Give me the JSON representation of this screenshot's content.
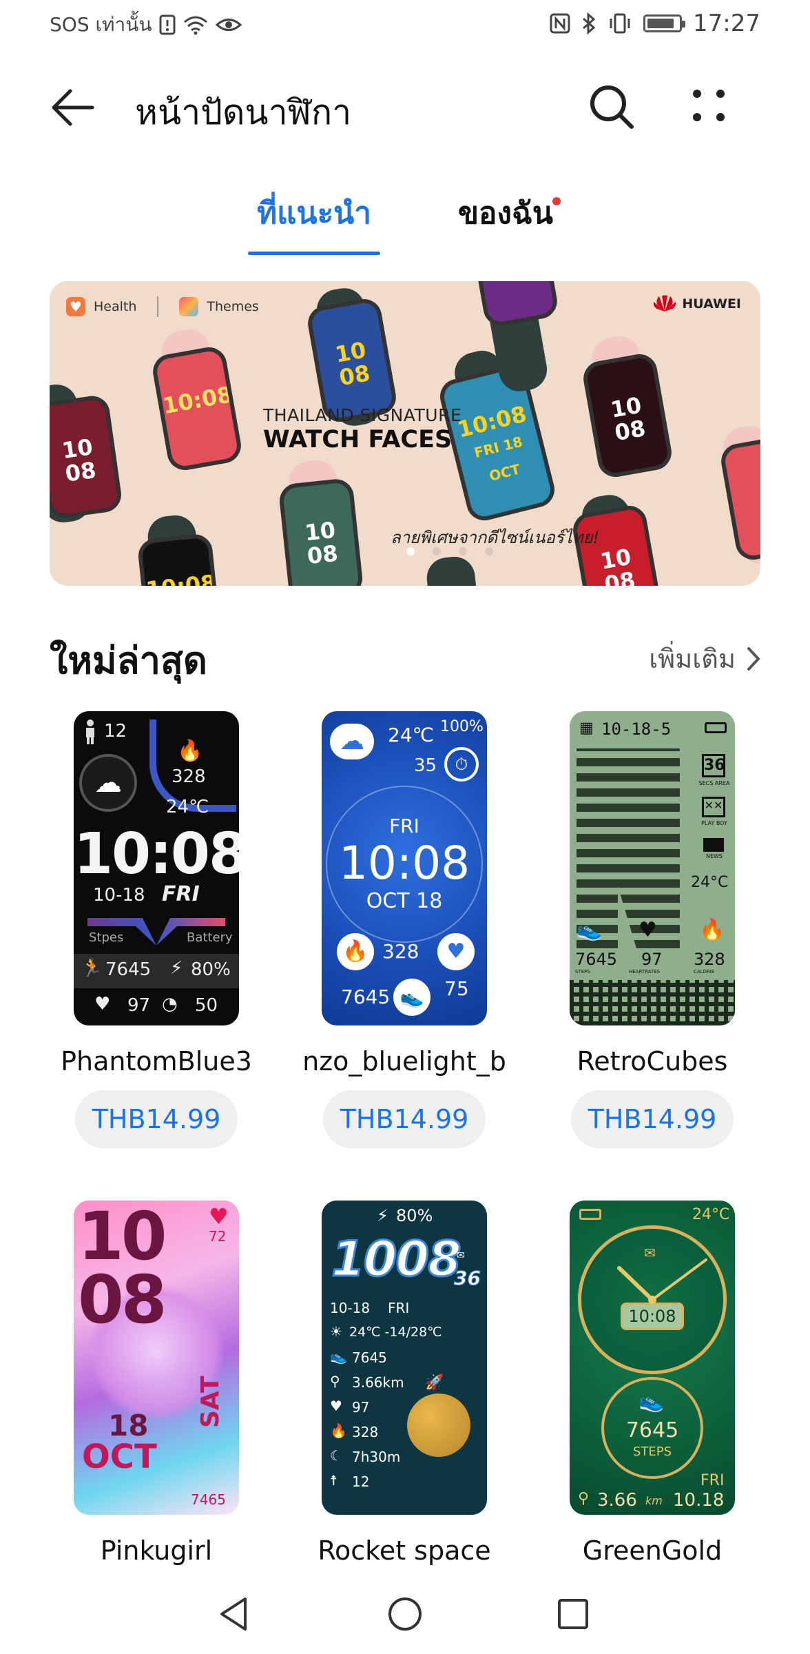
{
  "status_bar": {
    "left_text": "SOS เท่านั้น",
    "time": "17:27",
    "icons": [
      "alert-icon",
      "wifi-icon",
      "eye-icon",
      "nfc-icon",
      "bluetooth-icon",
      "vibrate-icon",
      "battery-icon"
    ]
  },
  "app_bar": {
    "title": "หน้าปัดนาฬิกา",
    "icons": [
      "back-arrow-icon",
      "search-icon",
      "more-icon"
    ]
  },
  "tabs": [
    {
      "label": "ที่แนะนำ",
      "selected": true
    },
    {
      "label": "ของฉัน",
      "selected": false,
      "has_notification_dot": true
    }
  ],
  "banner": {
    "brand_health": "Health",
    "brand_themes": "Themes",
    "brand_huawei": "HUAWEI",
    "headline_line1": "THAILAND SIGNATURE",
    "headline_line2": "WATCH FACES",
    "tagline": "ลายพิเศษจากดีไซน์เนอร์ไทย!",
    "page_count": 4,
    "active_page": 1,
    "colors": {
      "background": "#f1dccb"
    }
  },
  "section": {
    "title": "ใหม่ล่าสุด",
    "more_label": "เพิ่มเติม"
  },
  "items": [
    {
      "name": "PhantomBlue3",
      "price": "THB14.99",
      "face": {
        "time": "10:08",
        "date": "10-18",
        "day": "FRI",
        "temp": "24℃",
        "steps_count": "12",
        "calories": "328",
        "steps": "7645",
        "battery": "80%",
        "heart": "97",
        "stat": "50",
        "label_steps": "Stpes",
        "label_battery": "Battery"
      }
    },
    {
      "name": "nzo_bluelight_b",
      "price": "THB14.99",
      "face": {
        "temp": "24℃",
        "battery": "100%",
        "timer": "35",
        "day": "FRI",
        "time": "10:08",
        "date": "OCT 18",
        "calories": "328",
        "steps": "7645",
        "heart": "75"
      }
    },
    {
      "name": "RetroCubes",
      "price": "THB14.99",
      "face": {
        "date": "10-18-5",
        "secs": "36",
        "secs_label": "SECS AREA",
        "play_label": "PLAY BOY",
        "news_label": "NEWS",
        "temp": "24°C",
        "steps": "7645",
        "heart": "97",
        "calories": "328",
        "steps_label": "STEPS",
        "heart_label": "HEARTRATES",
        "cal_label": "CALORIE"
      }
    },
    {
      "name": "Pinkugirl",
      "face": {
        "hour": "10",
        "minute": "08",
        "day_num": "18",
        "month": "OCT",
        "weekday": "SAT",
        "heart": "72",
        "steps": "7465"
      }
    },
    {
      "name": "Rocket space",
      "face": {
        "battery": "80%",
        "time": "1008",
        "seconds": "36",
        "date": "10-18",
        "day": "FRI",
        "weather": "24℃ -14/28℃",
        "steps": "7645",
        "distance": "3.66km",
        "heart": "97",
        "calories": "328",
        "sleep": "7h30m",
        "stand": "12"
      }
    },
    {
      "name": "GreenGold",
      "face": {
        "temp": "24°C",
        "time": "10:08",
        "steps": "7645",
        "steps_label": "STEPS",
        "distance": "3.66",
        "distance_unit": "km",
        "day": "FRI",
        "date": "10.18"
      }
    }
  ],
  "nav_bar": {
    "icons": [
      "back-triangle-icon",
      "home-circle-icon",
      "recents-square-icon"
    ]
  }
}
